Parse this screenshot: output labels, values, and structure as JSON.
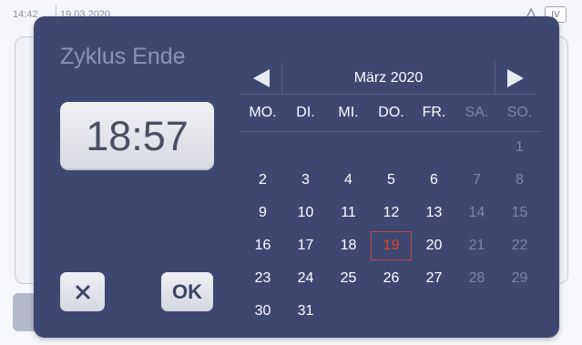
{
  "background": {
    "time": "14:42",
    "date": "19.03.2020",
    "badge": "IV"
  },
  "dialog": {
    "title": "Zyklus Ende",
    "time_value": "18:57",
    "cancel_icon": "close-icon",
    "ok_label": "OK"
  },
  "calendar": {
    "month_label": "März 2020",
    "prev_icon": "triangle-left-icon",
    "next_icon": "triangle-right-icon",
    "weekdays": [
      "MO.",
      "DI.",
      "MI.",
      "DO.",
      "FR.",
      "SA.",
      "SO."
    ],
    "weeks": [
      [
        "",
        "",
        "",
        "",
        "",
        "",
        "1"
      ],
      [
        "2",
        "3",
        "4",
        "5",
        "6",
        "7",
        "8"
      ],
      [
        "9",
        "10",
        "11",
        "12",
        "13",
        "14",
        "15"
      ],
      [
        "16",
        "17",
        "18",
        "19",
        "20",
        "21",
        "22"
      ],
      [
        "23",
        "24",
        "25",
        "26",
        "27",
        "28",
        "29"
      ],
      [
        "30",
        "31",
        "",
        "",
        "",
        "",
        ""
      ]
    ],
    "selected_day": "19"
  },
  "colors": {
    "dialog_bg": "#3d4770",
    "weekend_text": "#7d86a8",
    "today_text": "#e0462f"
  }
}
